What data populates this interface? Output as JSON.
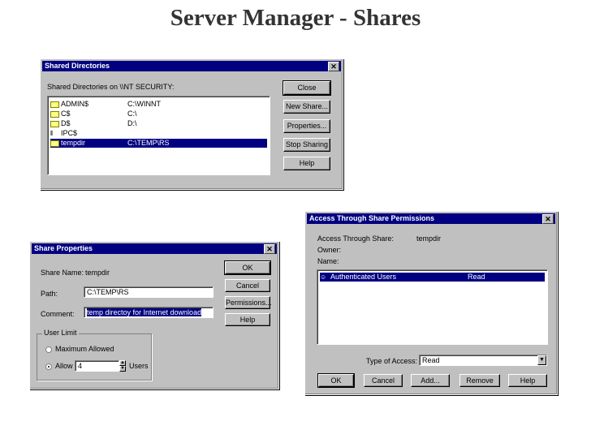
{
  "slide": {
    "title": "Server Manager - Shares"
  },
  "shared_directories": {
    "title": "Shared Directories",
    "close_glyph": "✕",
    "header": "Shared Directories on \\\\NT SECURITY:",
    "items": [
      {
        "name": "ADMIN$",
        "path": "C:\\WINNT",
        "icon": "shared-folder-icon",
        "selected": false
      },
      {
        "name": "C$",
        "path": "C:\\",
        "icon": "shared-folder-icon",
        "selected": false
      },
      {
        "name": "D$",
        "path": "D:\\",
        "icon": "shared-folder-icon",
        "selected": false
      },
      {
        "name": "IPC$",
        "path": "",
        "icon": "pipe-icon",
        "selected": false
      },
      {
        "name": "tempdir",
        "path": "C:\\TEMP\\RS",
        "icon": "shared-folder-icon",
        "selected": true
      }
    ],
    "buttons": {
      "close": "Close",
      "new_share": "New Share...",
      "properties": "Properties...",
      "stop_sharing": "Stop Sharing",
      "help": "Help"
    }
  },
  "share_properties": {
    "title": "Share Properties",
    "close_glyph": "✕",
    "share_name_label": "Share Name:",
    "share_name_value": "tempdir",
    "path_label": "Path:",
    "path_value": "C:\\TEMP\\RS",
    "comment_label": "Comment:",
    "comment_value": "temp directoy for Internet download",
    "user_limit_label": "User Limit",
    "max_allowed_label": "Maximum Allowed",
    "allow_label": "Allow",
    "allow_value": "4",
    "users_label": "Users",
    "buttons": {
      "ok": "OK",
      "cancel": "Cancel",
      "permissions": "Permissions...",
      "help": "Help"
    }
  },
  "permissions": {
    "title": "Access Through Share Permissions",
    "close_glyph": "✕",
    "access_label": "Access Through Share:",
    "access_value": "tempdir",
    "owner_label": "Owner:",
    "name_label": "Name:",
    "entries": [
      {
        "name": "Authenticated Users",
        "access": "Read",
        "selected": true
      }
    ],
    "type_label": "Type of Access:",
    "type_value": "Read",
    "buttons": {
      "ok": "OK",
      "cancel": "Cancel",
      "add": "Add...",
      "remove": "Remove",
      "help": "Help"
    }
  }
}
